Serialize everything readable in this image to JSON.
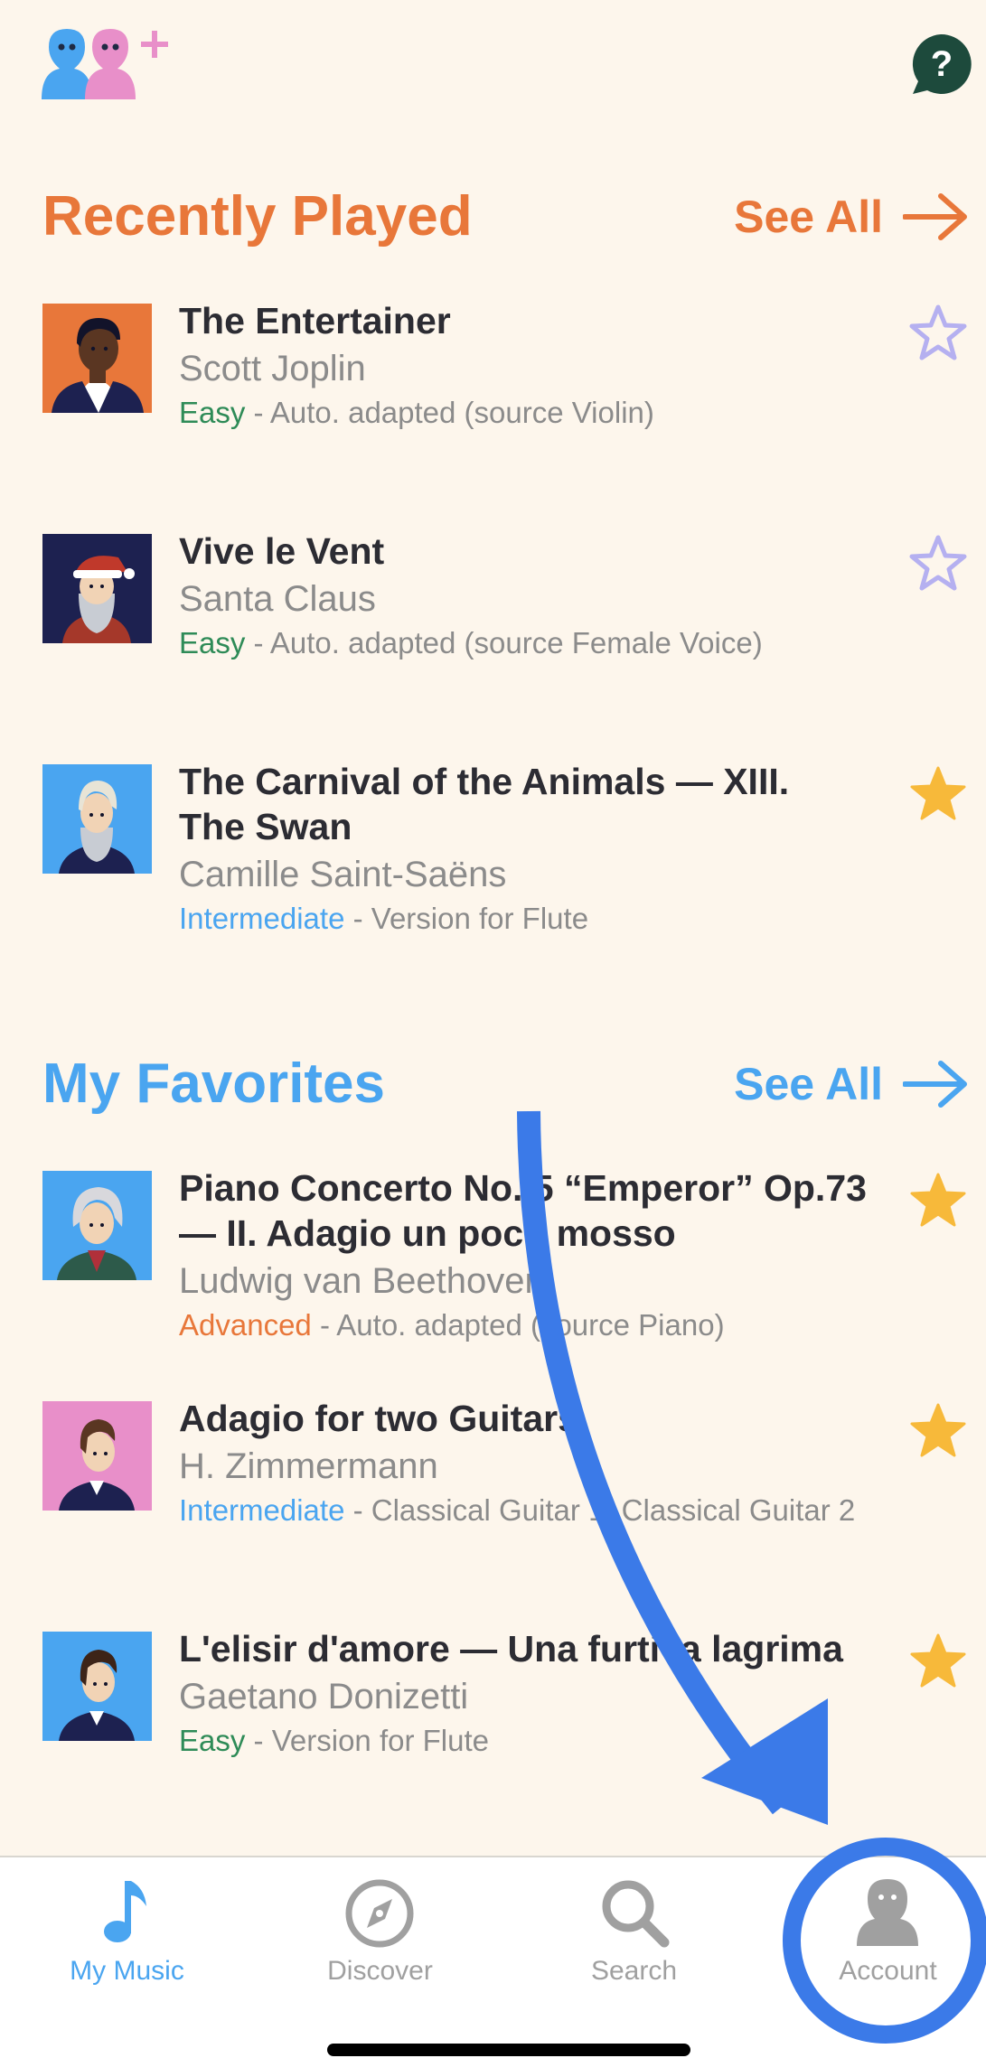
{
  "colors": {
    "background": "#fdf6ec",
    "recently_accent": "#e8773a",
    "favorites_accent": "#4aa5f0",
    "easy": "#2e8b57",
    "intermediate": "#4aa5f0",
    "advanced": "#e8773a",
    "star_filled": "#f7b93a",
    "star_outline": "#b5b0f0",
    "annotation": "#3b7ae8"
  },
  "header": {
    "left_icon": "add-friends-icon",
    "right_icon": "help-icon",
    "help_glyph": "?"
  },
  "recently_played": {
    "title": "Recently Played",
    "see_all": "See All",
    "items": [
      {
        "title_lines": [
          "The Entertainer"
        ],
        "artist": "Scott Joplin",
        "level": "Easy",
        "level_key": "easy",
        "info": " - Auto. adapted (source Violin)",
        "favorite": false,
        "avatar": "joplin"
      },
      {
        "title_lines": [
          "Vive le Vent"
        ],
        "artist": "Santa Claus",
        "level": "Easy",
        "level_key": "easy",
        "info": " - Auto. adapted (source Female Voice)",
        "favorite": false,
        "avatar": "santa"
      },
      {
        "title_lines": [
          "The Carnival of the Animals — XIII.",
          "The Swan"
        ],
        "artist": "Camille Saint-Saëns",
        "level": "Intermediate",
        "level_key": "intermediate",
        "info": " - Version for Flute",
        "favorite": true,
        "avatar": "saint-saens"
      }
    ]
  },
  "my_favorites": {
    "title": "My Favorites",
    "see_all": "See All",
    "items": [
      {
        "title_lines": [
          "Piano Concerto No. 5 “Emperor” Op.73",
          "— II. Adagio un poco mosso"
        ],
        "artist": "Ludwig van Beethoven",
        "level": "Advanced",
        "level_key": "advanced",
        "info": " - Auto. adapted (source Piano)",
        "favorite": true,
        "avatar": "beethoven"
      },
      {
        "title_lines": [
          "Adagio for two Guitars"
        ],
        "artist": "H. Zimmermann",
        "level": "Intermediate",
        "level_key": "intermediate",
        "info": " - Classical Guitar 1, Classical Guitar 2",
        "favorite": true,
        "avatar": "zimmermann"
      },
      {
        "title_lines": [
          "L'elisir d'amore — Una furtiva lagrima"
        ],
        "artist": "Gaetano Donizetti",
        "level": "Easy",
        "level_key": "easy",
        "info": " - Version for Flute",
        "favorite": true,
        "avatar": "donizetti"
      }
    ]
  },
  "tabbar": {
    "tabs": [
      {
        "label": "My Music",
        "icon": "music-note-icon",
        "active": true
      },
      {
        "label": "Discover",
        "icon": "compass-icon",
        "active": false
      },
      {
        "label": "Search",
        "icon": "search-icon",
        "active": false
      },
      {
        "label": "Account",
        "icon": "account-icon",
        "active": false
      }
    ]
  }
}
